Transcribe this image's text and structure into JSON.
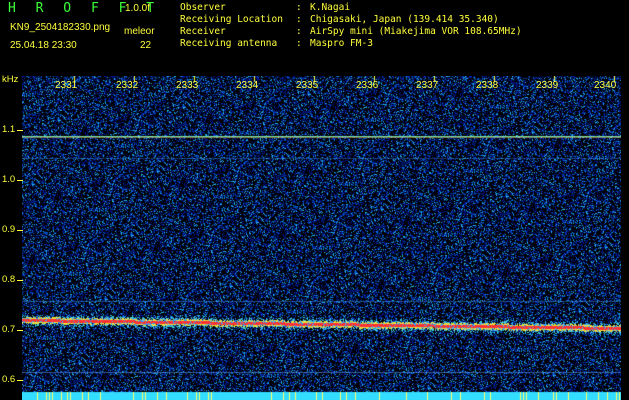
{
  "header": {
    "title": "H R O F F T",
    "version": "1.0.0f",
    "filename": "KN9_2504182330.png",
    "mode": "meleor",
    "datetime": "25.04.18 23:30",
    "count": "22"
  },
  "meta": [
    {
      "key": "Observer",
      "value": "K.Nagai"
    },
    {
      "key": "Receiving Location",
      "value": "Chigasaki, Japan (139.414 35.340)"
    },
    {
      "key": "Receiver",
      "value": "AirSpy mini (Miakejima VOR 108.65MHz)"
    },
    {
      "key": "Receiving antenna",
      "value": "Maspro FM-3"
    }
  ],
  "axis": {
    "unit": "kHz",
    "y_ticks": [
      "1.1",
      "1.0",
      "0.9",
      "0.8",
      "0.7",
      "0.6"
    ],
    "x_ticks": [
      "2331",
      "2332",
      "2333",
      "2334",
      "2335",
      "2336",
      "2337",
      "2338",
      "2339",
      "2340"
    ]
  },
  "colors": {
    "accent": "#ffff3c",
    "title": "#3cff3c",
    "noise": "#0a2aa0",
    "signal": "#ff2a2a"
  }
}
